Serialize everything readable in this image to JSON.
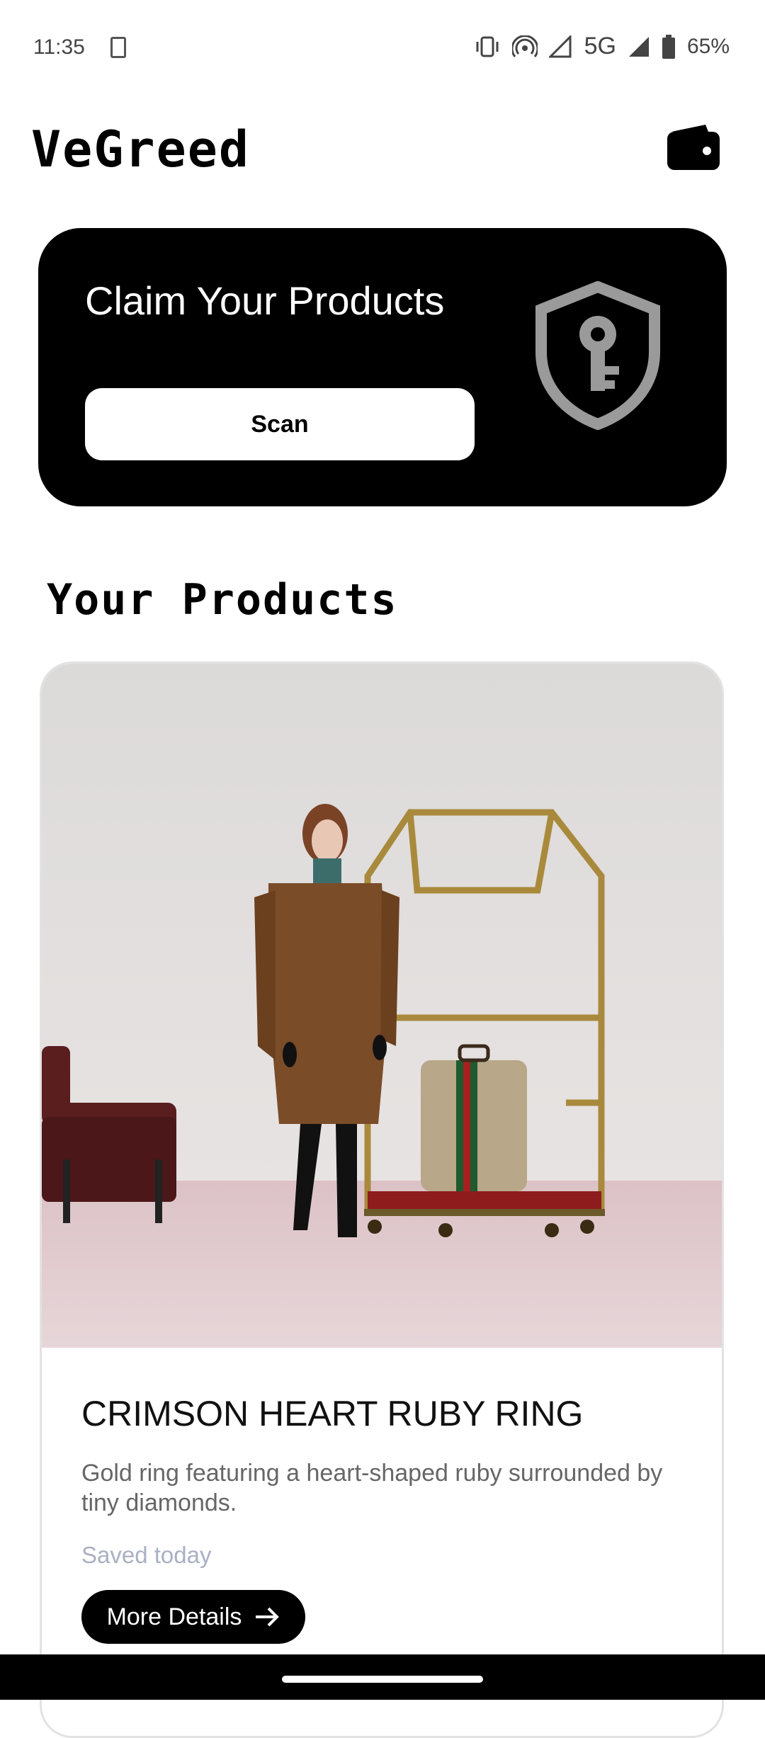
{
  "status": {
    "time": "11:35",
    "network": "5G",
    "battery": "65%"
  },
  "header": {
    "brand": "VeGreed",
    "wallet_icon": "wallet-icon"
  },
  "claim": {
    "title": "Claim Your Products",
    "scan_label": "Scan",
    "icon": "shield-key-icon"
  },
  "products_section": {
    "title": "Your Products"
  },
  "products": [
    {
      "name": "CRIMSON HEART RUBY RING",
      "description": "Gold ring featuring a heart-shaped ruby surrounded by tiny diamonds.",
      "saved": "Saved today",
      "details_label": "More Details"
    }
  ],
  "colors": {
    "card_bg": "#000000",
    "accent_text": "#ffffff",
    "muted": "#aab0c3"
  }
}
